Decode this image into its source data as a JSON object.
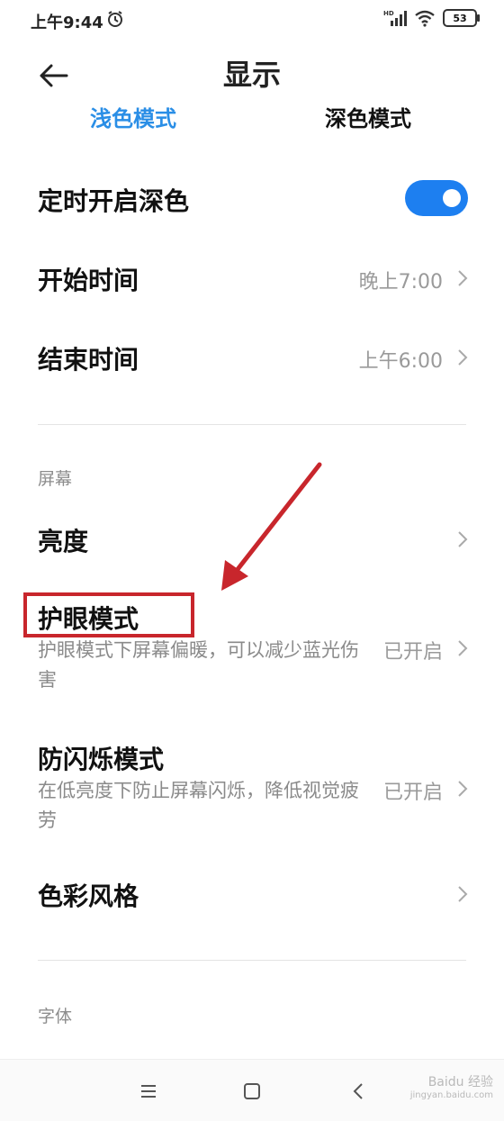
{
  "status_bar": {
    "time": "上午9:44",
    "battery": "53",
    "network_label": "HD"
  },
  "header": {
    "title": "显示"
  },
  "tabs": [
    {
      "label": "浅色模式"
    },
    {
      "label": "深色模式"
    }
  ],
  "schedule": {
    "toggle_label": "定时开启深色",
    "toggle_on": true,
    "start_label": "开始时间",
    "start_value": "晚上7:00",
    "end_label": "结束时间",
    "end_value": "上午6:00"
  },
  "screen_section": {
    "header": "屏幕",
    "brightness_label": "亮度",
    "eye_label": "护眼模式",
    "eye_desc": "护眼模式下屏幕偏暖，可以减少蓝光伤害",
    "eye_value": "已开启",
    "flicker_label": "防闪烁模式",
    "flicker_desc": "在低亮度下防止屏幕闪烁，降低视觉疲劳",
    "flicker_value": "已开启",
    "color_label": "色彩风格"
  },
  "font_section": {
    "header": "字体"
  },
  "watermark": {
    "brand": "Baidu 经验",
    "url": "jingyan.baidu.com"
  },
  "colors": {
    "accent": "#2a8ee6",
    "toggle": "#1d7ff0",
    "annotation": "#c8262c"
  }
}
